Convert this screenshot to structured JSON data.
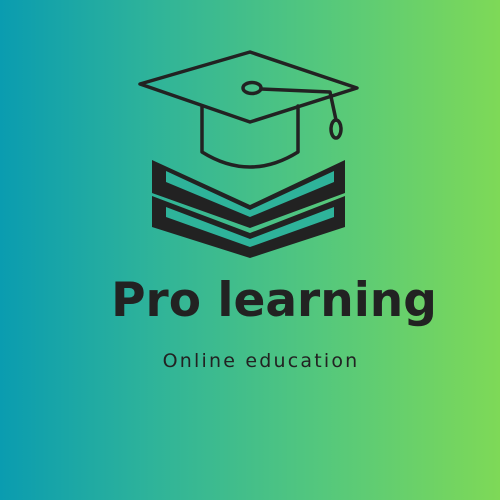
{
  "brand": {
    "name": "Pro learning",
    "tagline": "Online education"
  },
  "colors": {
    "gradient_start": "#0a9cb0",
    "gradient_end": "#7ed957",
    "ink": "#222222"
  },
  "icons": [
    "graduation-cap-icon",
    "books-stack-icon"
  ]
}
